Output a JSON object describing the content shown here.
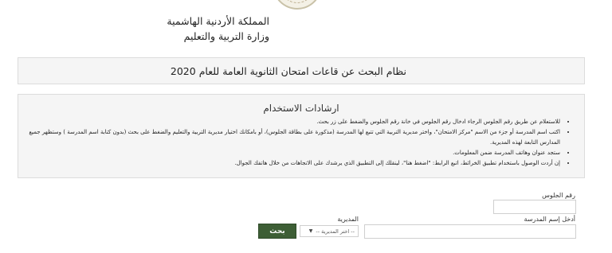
{
  "header": {
    "logo_icon": "ministry-seal-icon",
    "kingdom_name": "المملكة الأردنية الهاشمية",
    "ministry_name": "وزارة التربية والتعليم"
  },
  "system_title": "نظام البحث عن قاعات امتحان الثانوية العامة للعام 2020",
  "instructions": {
    "title": "ارشادات الاستخدام",
    "items": [
      "للاستعلام عن طريق رقم الجلوس الرجاء ادخال رقم الجلوس في خانة رقم الجلوس والضغط على زر بحث.",
      "اكتب اسم المدرسة أو جزء من الاسم \"مركز الامتحان\"، واختر مديرية التربية التي تتبع لها المدرسة (مذكورة على بطاقة الجلوس)، أو بامكانك اختيار مديرية التربية والتعليم والضغط على بحث (بدون كتابة اسم المدرسة ) وستظهر جميع المدارس التابعة لهذه المديرية.",
      "ستجد عنوان وهاتف المدرسة ضمن المعلومات.",
      "إن أردت الوصول باستخدام تطبيق الخرائط، اتبع الرابط: \"اضغط هنا\"، لينقلك إلى التطبيق الذي يرشدك على الاتجاهات من خلال هاتفك الجوال."
    ]
  },
  "form": {
    "seat_number_label": "رقم الجلوس",
    "seat_number_value": "",
    "school_name_label": "أدخل إسم المدرسة",
    "school_name_value": "",
    "directorate_label": "المديرية",
    "directorate_selected": "-- اختر المديرية --",
    "search_button": "بحث"
  }
}
